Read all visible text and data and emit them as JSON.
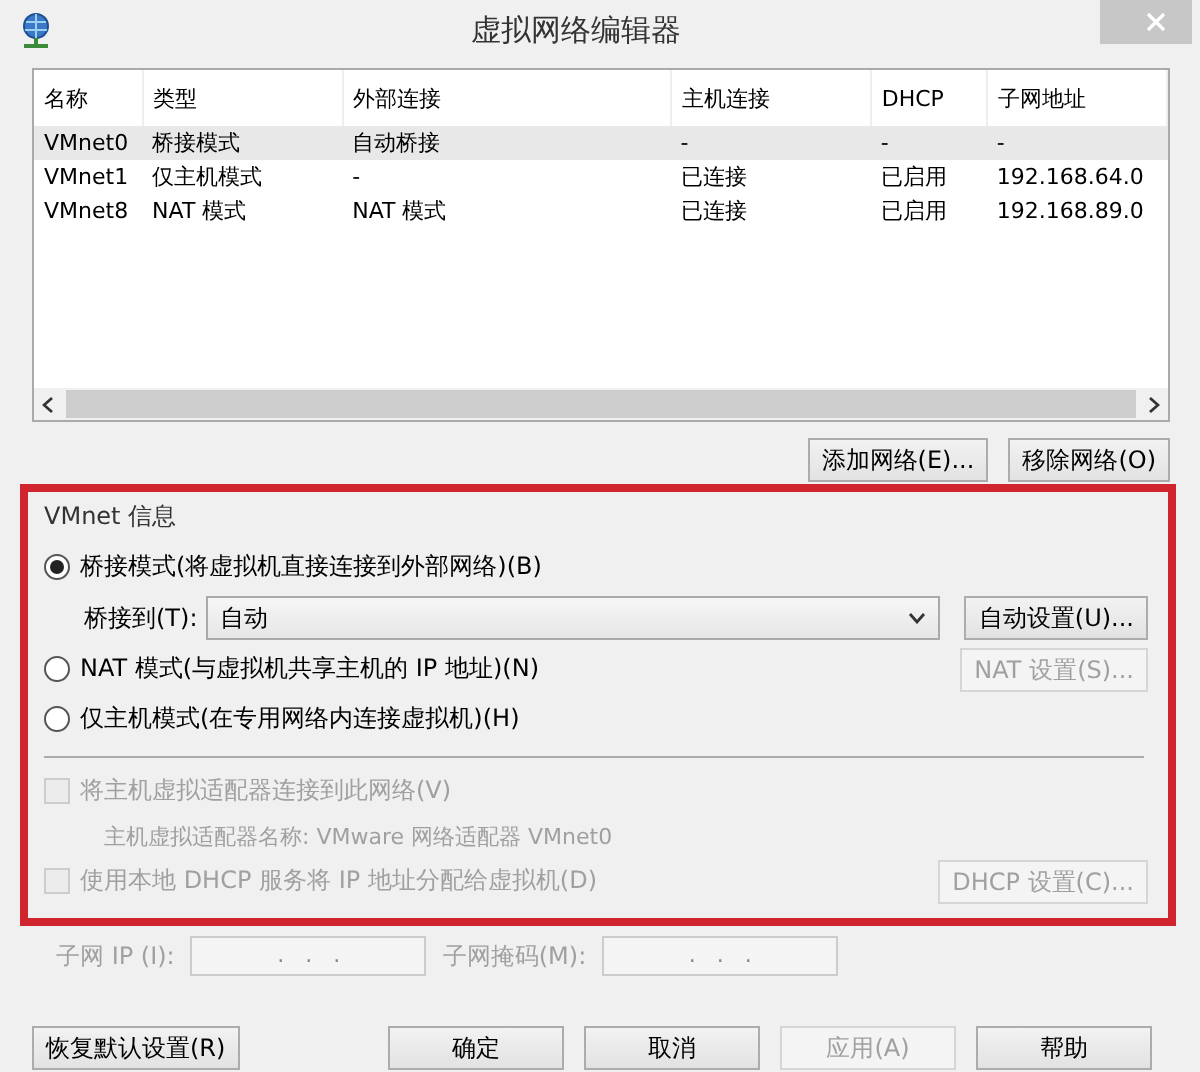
{
  "window": {
    "title": "虚拟网络编辑器"
  },
  "table": {
    "columns": [
      "名称",
      "类型",
      "外部连接",
      "主机连接",
      "DHCP",
      "子网地址"
    ],
    "rows": [
      {
        "cells": [
          "VMnet0",
          "桥接模式",
          "自动桥接",
          "-",
          "-",
          "-"
        ],
        "selected": true
      },
      {
        "cells": [
          "VMnet1",
          "仅主机模式",
          "-",
          "已连接",
          "已启用",
          "192.168.64.0"
        ],
        "selected": false
      },
      {
        "cells": [
          "VMnet8",
          "NAT 模式",
          "NAT 模式",
          "已连接",
          "已启用",
          "192.168.89.0"
        ],
        "selected": false
      }
    ]
  },
  "list_buttons": [
    {
      "label": "添加网络(E)...",
      "disabled": false
    },
    {
      "label": "移除网络(O)",
      "disabled": false
    }
  ],
  "vmnet_info": {
    "title": "VMnet 信息",
    "modes": [
      {
        "label": "桥接模式(将虚拟机直接连接到外部网络)(B)",
        "selected": true
      },
      {
        "label": "NAT 模式(与虚拟机共享主机的 IP 地址)(N)",
        "selected": false
      },
      {
        "label": "仅主机模式(在专用网络内连接虚拟机)(H)",
        "selected": false
      }
    ],
    "bridge_to": {
      "label": "桥接到(T):",
      "value": "自动"
    },
    "auto_settings": {
      "label": "自动设置(U)...",
      "disabled": false
    },
    "nat_settings": {
      "label": "NAT 设置(S)...",
      "disabled": true
    },
    "host_adapter": {
      "label": "将主机虚拟适配器连接到此网络(V)",
      "checked": false,
      "disabled": true
    },
    "adapter_name": "主机虚拟适配器名称: VMware 网络适配器 VMnet0",
    "dhcp": {
      "label": "使用本地 DHCP 服务将 IP 地址分配给虚拟机(D)",
      "checked": false,
      "disabled": true
    },
    "dhcp_settings": {
      "label": "DHCP 设置(C)...",
      "disabled": true
    }
  },
  "subnet": {
    "disabled": true,
    "ip_label": "子网 IP (I):",
    "ip_value": ".   .   .",
    "mask_label": "子网掩码(M):",
    "mask_value": ".   .   ."
  },
  "footer_buttons": [
    {
      "label": "恢复默认设置(R)",
      "disabled": false
    },
    {
      "label": "确定",
      "disabled": false
    },
    {
      "label": "取消",
      "disabled": false
    },
    {
      "label": "应用(A)",
      "disabled": true
    },
    {
      "label": "帮助",
      "disabled": false
    }
  ]
}
